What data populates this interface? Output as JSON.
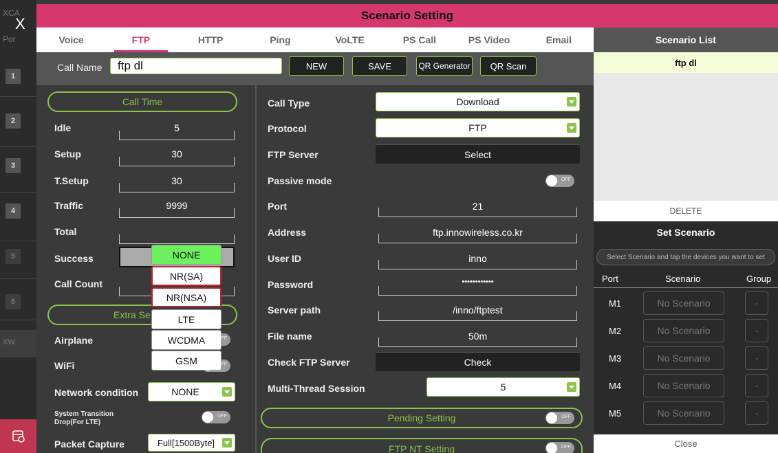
{
  "background": {
    "app_title_fragment": "XCA",
    "port_fragment": "Por",
    "rows": [
      "1",
      "2",
      "3",
      "4",
      "5",
      "6"
    ],
    "xw_fragment": "XW"
  },
  "close_glyph": "X",
  "dialog": {
    "title": "Scenario Setting",
    "tabs": [
      "Voice",
      "FTP",
      "HTTP",
      "Ping",
      "VoLTE",
      "PS Call",
      "PS Video",
      "Email"
    ],
    "active_tab": "FTP",
    "call_name": {
      "label": "Call Name",
      "value": "ftp dl",
      "buttons": {
        "new": "NEW",
        "save": "SAVE",
        "qr_generator": "QR Generator",
        "qr_scan": "QR Scan"
      }
    },
    "left": {
      "call_time_title": "Call Time",
      "fields": [
        {
          "label": "Idle",
          "value": "5"
        },
        {
          "label": "Setup",
          "value": "30"
        },
        {
          "label": "T.Setup",
          "value": "30"
        },
        {
          "label": "Traffic",
          "value": "9999"
        },
        {
          "label": "Total",
          "value": ""
        }
      ],
      "success_label": "Success",
      "call_count_label": "Call Count",
      "extra_title": "Extra Se",
      "airplane_label": "Airplane",
      "wifi_label": "WiFi",
      "network_condition_label": "Network condition",
      "network_condition_value": "NONE",
      "system_transition_label_1": "System Transition",
      "system_transition_label_2": "Drop(For LTE)",
      "packet_capture_label": "Packet Capture",
      "packet_capture_value": "Full[1500Byte]"
    },
    "dropdown": {
      "items": [
        "NONE",
        "NR(SA)",
        "NR(NSA)",
        "LTE",
        "WCDMA",
        "GSM"
      ],
      "selected": "NONE"
    },
    "right": {
      "call_type_label": "Call Type",
      "call_type_value": "Download",
      "protocol_label": "Protocol",
      "protocol_value": "FTP",
      "ftp_server_label": "FTP Server",
      "ftp_server_button": "Select",
      "passive_mode_label": "Passive mode",
      "port_label": "Port",
      "port_value": "21",
      "address_label": "Address",
      "address_value": "ftp.innowireless.co.kr",
      "user_id_label": "User ID",
      "user_id_value": "inno",
      "password_label": "Password",
      "password_value": "••••••••••••",
      "server_path_label": "Server path",
      "server_path_value": "/inno/ftptest",
      "file_name_label": "File name",
      "file_name_value": "50m",
      "check_ftp_label": "Check FTP Server",
      "check_button": "Check",
      "multi_thread_label": "Multi-Thread Session",
      "multi_thread_value": "5",
      "pending_setting": "Pending Setting",
      "ftp_nt_setting": "FTP NT Setting"
    },
    "toggle_off_text": "OFF"
  },
  "scenario_list": {
    "title": "Scenario List",
    "items": [
      "ftp dl"
    ],
    "delete": "DELETE",
    "set_title": "Set Scenario",
    "hint": "Select Scenario and tap the devices you want to set",
    "col_port": "Port",
    "col_scenario": "Scenario",
    "col_group": "Group",
    "ports": [
      {
        "port": "M1",
        "scenario": "No Scenario",
        "group": "-"
      },
      {
        "port": "M2",
        "scenario": "No Scenario",
        "group": "-"
      },
      {
        "port": "M3",
        "scenario": "No Scenario",
        "group": "-"
      },
      {
        "port": "M4",
        "scenario": "No Scenario",
        "group": "-"
      },
      {
        "port": "M5",
        "scenario": "No Scenario",
        "group": "-"
      }
    ],
    "close": "Close"
  },
  "colors": {
    "accent": "#d6386e",
    "green": "#8bc34a",
    "selected_green": "#6cf05c"
  }
}
